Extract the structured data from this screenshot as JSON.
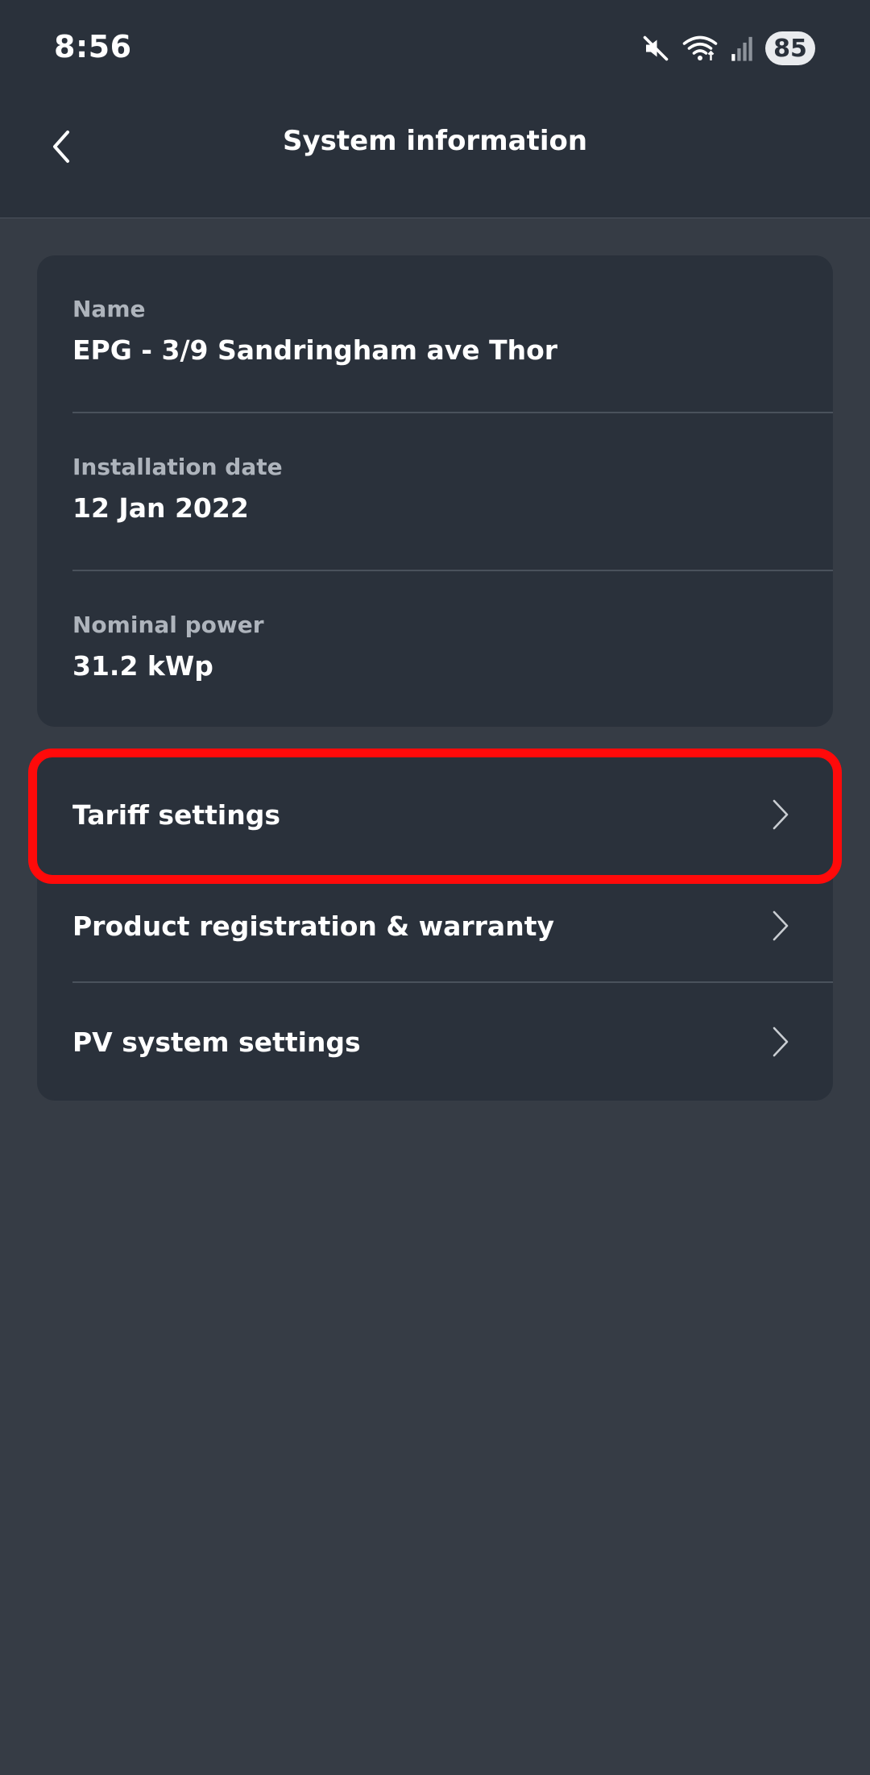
{
  "status_bar": {
    "time": "8:56",
    "battery": "85",
    "icons": [
      "mute-icon",
      "wifi-icon",
      "signal-icon"
    ]
  },
  "header": {
    "title": "System information",
    "back_icon": "chevron-left-icon"
  },
  "info": [
    {
      "label": "Name",
      "value": "EPG - 3/9 Sandringham ave Thor"
    },
    {
      "label": "Installation date",
      "value": "12 Jan 2022"
    },
    {
      "label": "Nominal power",
      "value": "31.2 kWp"
    }
  ],
  "nav": [
    {
      "label": "Tariff settings",
      "highlighted": true
    },
    {
      "label": "Product registration & warranty"
    },
    {
      "label": "PV system settings"
    }
  ],
  "colors": {
    "background": "#363c45",
    "card": "#2a313b",
    "highlight": "#ff0a0a"
  }
}
